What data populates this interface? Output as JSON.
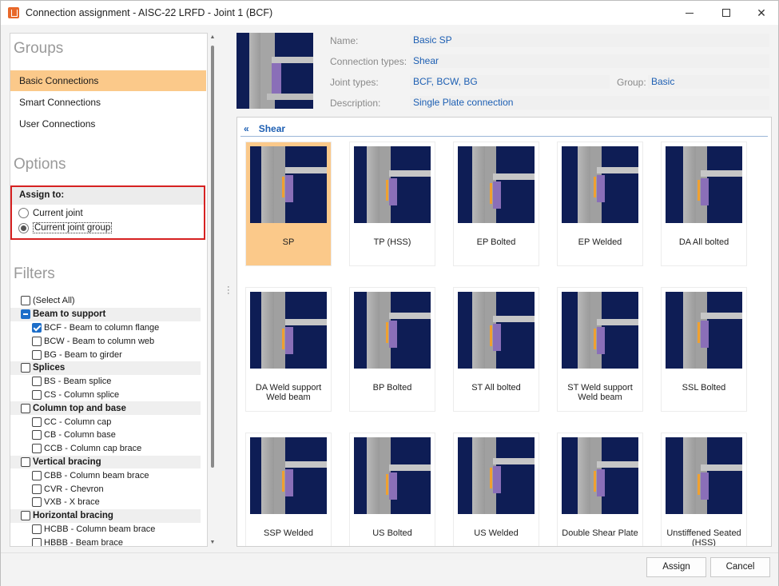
{
  "window": {
    "title": "Connection assignment - AISC-22 LRFD - Joint 1 (BCF)"
  },
  "groups": {
    "heading": "Groups",
    "items": [
      {
        "label": "Basic Connections",
        "selected": true
      },
      {
        "label": "Smart Connections",
        "selected": false
      },
      {
        "label": "User Connections",
        "selected": false
      }
    ]
  },
  "options": {
    "heading": "Options",
    "assign_to": "Assign to:",
    "current_joint": "Current joint",
    "current_joint_group": "Current joint group",
    "selected": "current_joint_group"
  },
  "filters": {
    "heading": "Filters",
    "select_all": "(Select All)",
    "rows": [
      {
        "label": "Beam to support",
        "level": 0,
        "state": "partial"
      },
      {
        "label": "BCF - Beam to column flange",
        "level": 1,
        "state": "checked"
      },
      {
        "label": "BCW - Beam to column web",
        "level": 1,
        "state": "unchecked"
      },
      {
        "label": "BG - Beam to girder",
        "level": 1,
        "state": "unchecked"
      },
      {
        "label": "Splices",
        "level": 0,
        "state": "unchecked"
      },
      {
        "label": "BS - Beam splice",
        "level": 1,
        "state": "unchecked"
      },
      {
        "label": "CS - Column splice",
        "level": 1,
        "state": "unchecked"
      },
      {
        "label": "Column top and base",
        "level": 0,
        "state": "unchecked"
      },
      {
        "label": "CC - Column cap",
        "level": 1,
        "state": "unchecked"
      },
      {
        "label": "CB - Column base",
        "level": 1,
        "state": "unchecked"
      },
      {
        "label": "CCB - Column cap brace",
        "level": 1,
        "state": "unchecked"
      },
      {
        "label": "Vertical bracing",
        "level": 0,
        "state": "unchecked"
      },
      {
        "label": "CBB - Column beam brace",
        "level": 1,
        "state": "unchecked"
      },
      {
        "label": "CVR - Chevron",
        "level": 1,
        "state": "unchecked"
      },
      {
        "label": "VXB - X brace",
        "level": 1,
        "state": "unchecked"
      },
      {
        "label": "Horizontal bracing",
        "level": 0,
        "state": "unchecked"
      },
      {
        "label": "HCBB - Column beam brace",
        "level": 1,
        "state": "unchecked"
      },
      {
        "label": "HBBB - Beam brace",
        "level": 1,
        "state": "unchecked"
      }
    ]
  },
  "details": {
    "name_label": "Name:",
    "name_value": "Basic SP",
    "types_label": "Connection types:",
    "types_value": "Shear",
    "joint_label": "Joint types:",
    "joint_value": "BCF, BCW, BG",
    "group_label": "Group:",
    "group_value": "Basic",
    "desc_label": "Description:",
    "desc_value": "Single Plate connection"
  },
  "category": {
    "label": "Shear"
  },
  "connections": [
    {
      "label": "SP",
      "selected": true
    },
    {
      "label": "TP (HSS)",
      "selected": false
    },
    {
      "label": "EP Bolted",
      "selected": false
    },
    {
      "label": "EP Welded",
      "selected": false
    },
    {
      "label": "DA All bolted",
      "selected": false
    },
    {
      "label": "DA Weld support\nWeld beam",
      "selected": false
    },
    {
      "label": "BP Bolted",
      "selected": false
    },
    {
      "label": "ST All bolted",
      "selected": false
    },
    {
      "label": "ST Weld support\nWeld beam",
      "selected": false
    },
    {
      "label": "SSL Bolted",
      "selected": false
    },
    {
      "label": "SSP Welded",
      "selected": false
    },
    {
      "label": "US Bolted",
      "selected": false
    },
    {
      "label": "US Welded",
      "selected": false
    },
    {
      "label": "Double Shear Plate",
      "selected": false
    },
    {
      "label": "Unstiffened Seated\n(HSS)",
      "selected": false
    }
  ],
  "buttons": {
    "assign": "Assign",
    "cancel": "Cancel"
  },
  "colors": {
    "selection": "#fbc98a",
    "accent": "#1d5fb3",
    "thumb_bg": "#0e1d55",
    "highlight_box": "#d62121"
  }
}
